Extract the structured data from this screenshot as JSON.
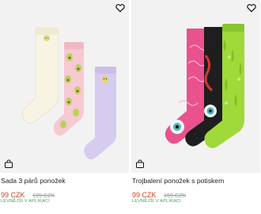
{
  "products": [
    {
      "title": "Sada 3 párů ponožek",
      "price": "99 CZK",
      "old_price": "199 CZK",
      "promo": "LEVNĚJŠÍ V APLIKACI"
    },
    {
      "title": "Trojbalení ponožek s potiskem",
      "price": "99 CZK",
      "old_price": "159 CZK",
      "promo": "LEVNĚJŠÍ V APLIKACI"
    }
  ],
  "icons": {
    "favorite": "heart-outline-icon",
    "bag": "shopping-bag-icon"
  },
  "colors": {
    "price": "#d0402e",
    "promo": "#3aa548",
    "image_bg": "#f2f2f2"
  }
}
